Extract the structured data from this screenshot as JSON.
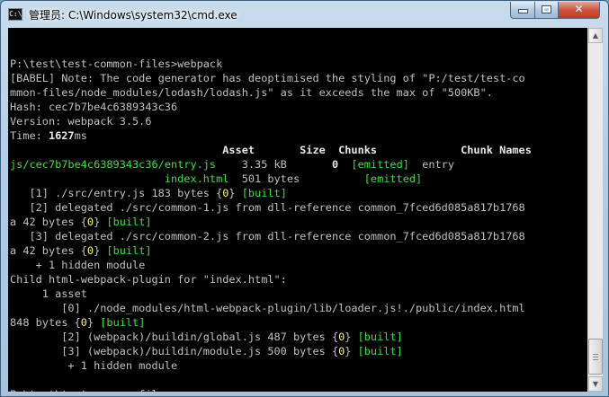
{
  "window": {
    "title": "管理员: C:\\Windows\\system32\\cmd.exe"
  },
  "controls": {
    "minimize": "minimize",
    "maximize": "maximize",
    "close": "✕"
  },
  "console": {
    "lines": [
      [
        {
          "t": ""
        }
      ],
      [
        {
          "t": "P:\\test\\test-common-files>webpack"
        }
      ],
      [
        {
          "t": "[BABEL] Note: The code generator has deoptimised the styling of \"P:/test/test-co"
        }
      ],
      [
        {
          "t": "mmon-files/node_modules/lodash/lodash.js\" as it exceeds the max of \"500KB\"."
        }
      ],
      [
        {
          "t": "Hash: cec7b7be4c6389343c36"
        }
      ],
      [
        {
          "t": "Version: webpack 3.5.6"
        }
      ],
      [
        {
          "t": "Time: "
        },
        {
          "t": "1627",
          "c": "w"
        },
        {
          "t": "ms"
        }
      ],
      [
        {
          "t": "                                 Asset       Size  Chunks             Chunk Names",
          "c": "w"
        }
      ],
      [
        {
          "t": "js/cec7b7be4c6389343c36/entry.js",
          "c": "g"
        },
        {
          "t": "    3.35 kB       "
        },
        {
          "t": "0",
          "c": "w"
        },
        {
          "t": "  "
        },
        {
          "t": "[emitted]",
          "c": "g"
        },
        {
          "t": "  entry"
        }
      ],
      [
        {
          "t": "                        "
        },
        {
          "t": "index.html",
          "c": "g"
        },
        {
          "t": "  501 bytes          "
        },
        {
          "t": "[emitted]",
          "c": "g"
        }
      ],
      [
        {
          "t": "   [1] ./src/entry.js 183 bytes {"
        },
        {
          "t": "0",
          "c": "y"
        },
        {
          "t": "} "
        },
        {
          "t": "[built]",
          "c": "g"
        }
      ],
      [
        {
          "t": "   [2] delegated ./src/common-1.js from dll-reference common_7fced6d085a817b1768"
        }
      ],
      [
        {
          "t": "a 42 bytes {"
        },
        {
          "t": "0",
          "c": "y"
        },
        {
          "t": "} "
        },
        {
          "t": "[built]",
          "c": "g"
        }
      ],
      [
        {
          "t": "   [3] delegated ./src/common-2.js from dll-reference common_7fced6d085a817b1768"
        }
      ],
      [
        {
          "t": "a 42 bytes {"
        },
        {
          "t": "0",
          "c": "y"
        },
        {
          "t": "} "
        },
        {
          "t": "[built]",
          "c": "g"
        }
      ],
      [
        {
          "t": "    + 1 hidden module"
        }
      ],
      [
        {
          "t": "Child html-webpack-plugin for \"index.html\":"
        }
      ],
      [
        {
          "t": "     1 asset"
        }
      ],
      [
        {
          "t": "        [0] ./node_modules/html-webpack-plugin/lib/loader.js!./public/index.html"
        }
      ],
      [
        {
          "t": "848 bytes {"
        },
        {
          "t": "0",
          "c": "y"
        },
        {
          "t": "} "
        },
        {
          "t": "[built]",
          "c": "g"
        }
      ],
      [
        {
          "t": "        [2] (webpack)/buildin/global.js 487 bytes {"
        },
        {
          "t": "0",
          "c": "y"
        },
        {
          "t": "} "
        },
        {
          "t": "[built]",
          "c": "g"
        }
      ],
      [
        {
          "t": "        [3] (webpack)/buildin/module.js 500 bytes {"
        },
        {
          "t": "0",
          "c": "y"
        },
        {
          "t": "} "
        },
        {
          "t": "[built]",
          "c": "g"
        }
      ],
      [
        {
          "t": "         + 1 hidden module"
        }
      ],
      [
        {
          "t": ""
        }
      ],
      [
        {
          "t": "P:\\test\\test-common-files>"
        }
      ]
    ]
  },
  "icons": {
    "app": "cmd-icon",
    "scroll_up": "arrow-up-icon",
    "scroll_down": "arrow-down-icon"
  }
}
